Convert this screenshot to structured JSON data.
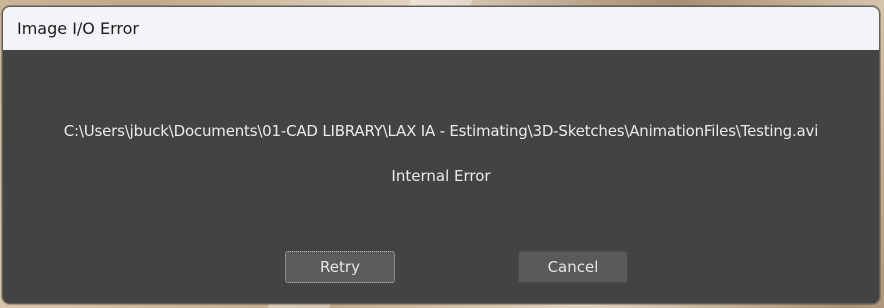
{
  "dialog": {
    "title": "Image I/O Error",
    "path": "C:\\Users\\jbuck\\Documents\\01-CAD LIBRARY\\LAX IA - Estimating\\3D-Sketches\\AnimationFiles\\Testing.avi",
    "message": "Internal Error",
    "buttons": {
      "retry_label": "Retry",
      "cancel_label": "Cancel"
    }
  },
  "colors": {
    "titlebar_bg": "#f2f4f7",
    "dialog_bg": "#434343",
    "button_bg": "#5a5a5a",
    "text": "#ebebeb"
  }
}
